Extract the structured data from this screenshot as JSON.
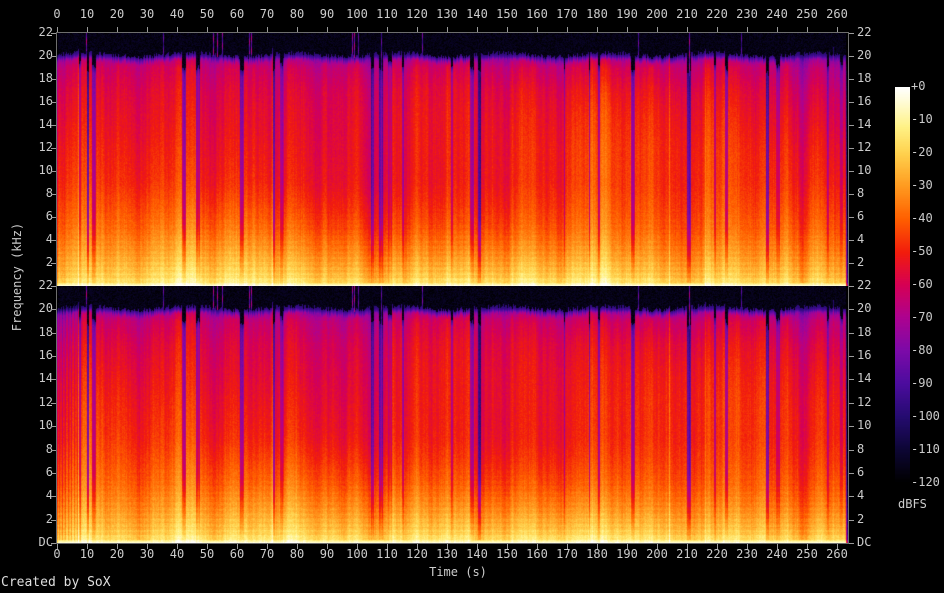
{
  "footer": {
    "credit": "Created by SoX"
  },
  "chart_data": {
    "type": "heatmap",
    "subtype": "stereo-audio-spectrogram",
    "title": "",
    "xlabel": "Time (s)",
    "ylabel": "Frequency (kHz)",
    "x_tick_labels": [
      "0",
      "10",
      "20",
      "30",
      "40",
      "50",
      "60",
      "70",
      "80",
      "90",
      "100",
      "110",
      "120",
      "130",
      "140",
      "150",
      "160",
      "170",
      "180",
      "190",
      "200",
      "210",
      "220",
      "230",
      "240",
      "250",
      "260"
    ],
    "x_range_s": [
      0,
      263.7
    ],
    "y_tick_labels": [
      "22",
      "20",
      "18",
      "16",
      "14",
      "12",
      "10",
      "8",
      "6",
      "4",
      "2"
    ],
    "dc_label": "DC",
    "y_range_khz": [
      0,
      22.05
    ],
    "channels": [
      "channel-1-top",
      "channel-2-bottom"
    ],
    "grid": false,
    "legend_position": "right-colorbar",
    "colorbar": {
      "unit": "dBFS",
      "tick_labels": [
        "+0",
        "-10",
        "-20",
        "-30",
        "-40",
        "-50",
        "-60",
        "-70",
        "-80",
        "-90",
        "-100",
        "-110",
        "-120"
      ],
      "range_db": [
        0,
        -120
      ],
      "stops": [
        {
          "db": 0,
          "color": "#ffffff"
        },
        {
          "db": -5,
          "color": "#fffbd0"
        },
        {
          "db": -12,
          "color": "#fff286"
        },
        {
          "db": -20,
          "color": "#ffd24e"
        },
        {
          "db": -30,
          "color": "#ff9b20"
        },
        {
          "db": -40,
          "color": "#ff5f00"
        },
        {
          "db": -50,
          "color": "#f21d0c"
        },
        {
          "db": -60,
          "color": "#d60054"
        },
        {
          "db": -70,
          "color": "#ad0290"
        },
        {
          "db": -80,
          "color": "#7c0aa8"
        },
        {
          "db": -90,
          "color": "#4c0c9e"
        },
        {
          "db": -100,
          "color": "#250b70"
        },
        {
          "db": -110,
          "color": "#0d0635"
        },
        {
          "db": -120,
          "color": "#000000"
        }
      ]
    },
    "spectral_profile_db": [
      {
        "khz": 0.0,
        "db": -6
      },
      {
        "khz": 0.12,
        "db": -11
      },
      {
        "khz": 0.35,
        "db": -17
      },
      {
        "khz": 0.7,
        "db": -21
      },
      {
        "khz": 1.2,
        "db": -24
      },
      {
        "khz": 2,
        "db": -28
      },
      {
        "khz": 3,
        "db": -33
      },
      {
        "khz": 4,
        "db": -37
      },
      {
        "khz": 5,
        "db": -41
      },
      {
        "khz": 7,
        "db": -46
      },
      {
        "khz": 9,
        "db": -50
      },
      {
        "khz": 12,
        "db": -52
      },
      {
        "khz": 15,
        "db": -55
      },
      {
        "khz": 17,
        "db": -58
      },
      {
        "khz": 19,
        "db": -64
      },
      {
        "khz": 19.8,
        "db": -72
      },
      {
        "khz": 20.2,
        "db": -95
      },
      {
        "khz": 20.6,
        "db": -110
      },
      {
        "khz": 22.05,
        "db": -118
      }
    ],
    "render_seeds": {
      "columns": 20240601,
      "channel1": 1234567,
      "channel2": 7654321
    }
  }
}
